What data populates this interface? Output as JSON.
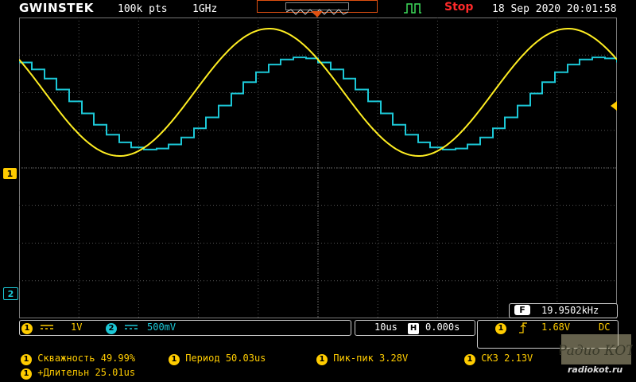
{
  "header": {
    "brand": "GWINSTEK",
    "record_length": "100k pts",
    "sample_rate": "1GHz",
    "run_status": "Stop",
    "datetime": "18 Sep 2020 20:01:58"
  },
  "channels": {
    "ch1": {
      "marker": "1",
      "coupling_icon": "dc-coupling-icon",
      "scale": "1V",
      "color": "#ffcc00"
    },
    "ch2": {
      "marker": "2",
      "coupling_icon": "dc-coupling-icon",
      "scale": "500mV",
      "color": "#1cc7d6"
    }
  },
  "timebase": {
    "scale": "10us",
    "position_icon": "H",
    "position": "0.000s"
  },
  "trigger": {
    "source": "1",
    "slope_icon": "rising-edge-icon",
    "level": "1.68V",
    "coupling": "DC"
  },
  "frequency_counter": {
    "badge": "F",
    "value": "19.9502kHz"
  },
  "measurements": [
    {
      "source": "1",
      "label": "Скважность",
      "value": "49.99%"
    },
    {
      "source": "1",
      "label": "Период",
      "value": "50.03us"
    },
    {
      "source": "1",
      "label": "Пик-пик",
      "value": "3.28V"
    },
    {
      "source": "1",
      "label": "СКЗ",
      "value": "2.13V"
    },
    {
      "source": "1",
      "label": "+Длительн",
      "value": "25.01us"
    }
  ],
  "watermark": {
    "brand": "Радио КОТ",
    "url": "radiokot.ru"
  },
  "waveforms": {
    "ch1": {
      "shape": "sine",
      "frequency": "19.9502kHz",
      "peak_to_peak": "3.28V"
    },
    "ch2": {
      "shape": "staircase-sine",
      "steps_per_period": 24
    }
  }
}
